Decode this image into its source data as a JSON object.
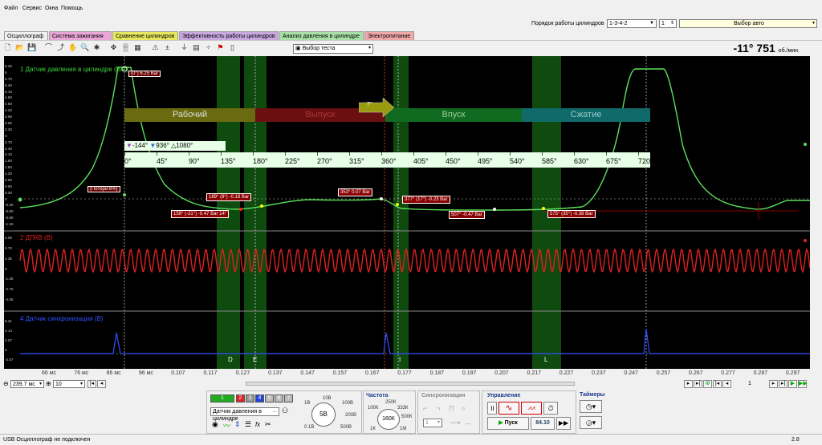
{
  "menu": {
    "file": "Файл",
    "service": "Сервис",
    "windows": "Окна",
    "help": "Помощь"
  },
  "header": {
    "cyl_order_label": "Порядок работы цилиндров",
    "cyl_order_value": "1-3-4-2",
    "cyl_num": "1",
    "car_select": "Выбор авто"
  },
  "tabs": [
    {
      "label": "Осциллограф",
      "color": "#ffffff"
    },
    {
      "label": "Система зажигания",
      "color": "#e9a6d6"
    },
    {
      "label": "Сравнение цилиндров",
      "color": "#e8e860"
    },
    {
      "label": "Эффективность работы цилиндров",
      "color": "#c9a8e0"
    },
    {
      "label": "Анализ давления в цилиндре",
      "color": "#a8e0a8"
    },
    {
      "label": "Электропитание",
      "color": "#f0a8a8"
    }
  ],
  "toolbar": {
    "test_select": "Выбор теста"
  },
  "rpm": {
    "value": "-11° 751",
    "unit": "об./мин."
  },
  "ch1": {
    "title": "1 Датчик давления в цилиндре (Bar)",
    "top_label": "(0°) 6.25 Bar",
    "loss": "(Потери:6%)",
    "yticks": [
      "6.20",
      "6",
      "5.70",
      "5.40",
      "5.10",
      "4.80",
      "4.50",
      "4.20",
      "3.90",
      "3.60",
      "3.30",
      "3",
      "2.70",
      "2.40",
      "2.10",
      "1.80",
      "1.50",
      "1.20",
      "0.90",
      "0.60",
      "0.30",
      "0",
      "-0.30",
      "-0.60",
      "-0.90",
      "-1.20"
    ],
    "phases": [
      "Рабочий",
      "Выпуск",
      "Впуск",
      "Сжатие"
    ],
    "arrow_label": "7°",
    "cursor_left": "-144°",
    "cursor_right": "936°",
    "cursor_delta": "1080°",
    "deg": [
      "0°",
      "45°",
      "90°",
      "135°",
      "180°",
      "225°",
      "270°",
      "315°",
      "360°",
      "405°",
      "450°",
      "495°",
      "540°",
      "585°",
      "630°",
      "675°",
      "720°"
    ],
    "anns": [
      "189° (9°) -0.18 Bar",
      "159° (-21°) -0.47 Bar 14°",
      "353° 0.07 Bar",
      "377° (17°) -0.23 Bar",
      "507° -0.47 Bar",
      "575° (35°) -0.38 Bar"
    ]
  },
  "ch2": {
    "title": "2 ДПКВ (В)",
    "yticks": [
      "4.05",
      "2.70",
      "1.35",
      "0",
      "-1.35",
      "-2.70",
      "-4.05"
    ]
  },
  "ch4": {
    "title": "4 Датчик синхронизации (В)",
    "yticks": [
      "6.21",
      "4.14",
      "2.07",
      "0",
      "-2.07"
    ],
    "markers": [
      "D",
      "E",
      "I",
      "L"
    ]
  },
  "xaxis": [
    "66 мс",
    "76 мс",
    "86 мс",
    "96 мс",
    "0.107",
    "0.117",
    "0.127",
    "0.137",
    "0.147",
    "0.157",
    "0.167",
    "0.177",
    "0.187",
    "0.197",
    "0.207",
    "0.217",
    "0.227",
    "0.237",
    "0.247",
    "0.257",
    "0.267",
    "0.277",
    "0.287",
    "0.297"
  ],
  "timebase": {
    "span": "239.7 мс",
    "zoom": "10",
    "page": "1"
  },
  "bottom": {
    "channels": [
      "1",
      "2",
      "3",
      "4",
      "5",
      "6",
      "7"
    ],
    "channel_select": "Датчик давления в цилиндре",
    "voltage": "5В",
    "v_ticks": [
      "1В",
      "10В",
      "100В",
      "200В",
      "0.1В",
      "500В"
    ],
    "freq_title": "Частота",
    "freq": "160К",
    "f_ticks": [
      "250К",
      "100К",
      "333К",
      "500К",
      "1К",
      "1М"
    ],
    "sync_title": "Синхронизация",
    "sync_ch": "1",
    "control_title": "Управление",
    "start": "Пуск",
    "fps": "84.10",
    "timers_title": "Таймеры"
  },
  "status": {
    "text": "USB Осциллограф не подключен",
    "version": "2.8"
  }
}
